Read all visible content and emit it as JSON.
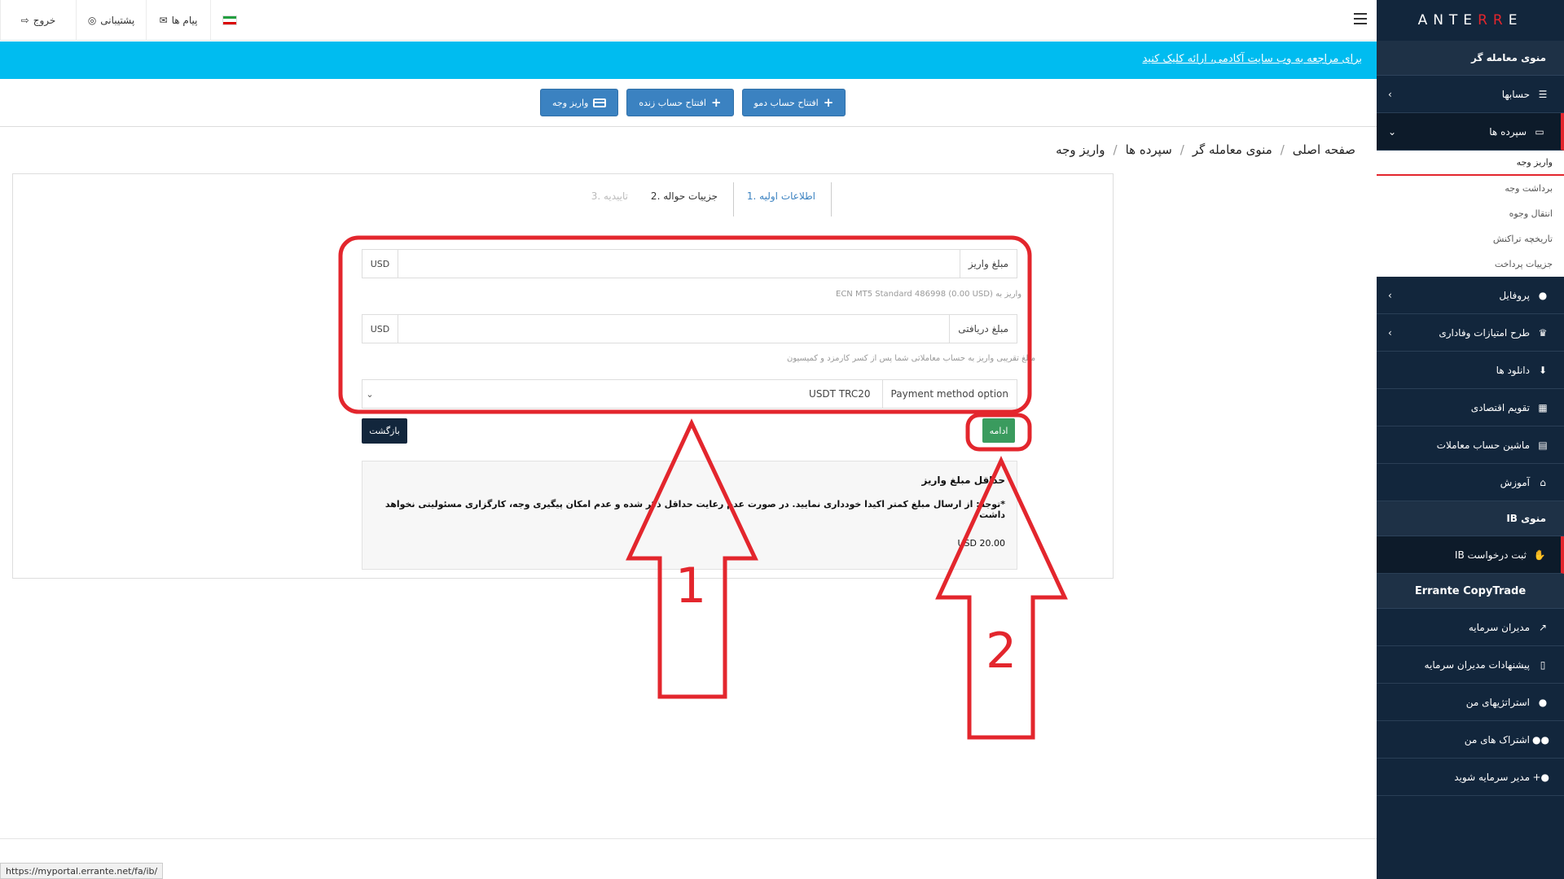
{
  "logo": {
    "text_left": "E",
    "text_rr": "RR",
    "text_right": "ANTE"
  },
  "sidebar": {
    "section_trader": "منوی معامله گر",
    "items_trader": [
      {
        "label": "حسابها",
        "icon": "list-icon",
        "chevron": "›"
      },
      {
        "label": "سپرده ها",
        "icon": "wallet-icon",
        "chevron": "⌄"
      }
    ],
    "sub_items": [
      "واریز وجه",
      "برداشت وجه",
      "انتقال وجوه",
      "تاریخچه تراکنش",
      "جزییات پرداخت"
    ],
    "items_trader2": [
      {
        "label": "پروفایل",
        "icon": "user-icon",
        "chevron": "›"
      },
      {
        "label": "طرح امتیازات وفاداری",
        "icon": "trophy-icon",
        "chevron": "›"
      },
      {
        "label": "دانلود ها",
        "icon": "download-icon"
      },
      {
        "label": "تقویم اقتصادی",
        "icon": "calendar-icon"
      },
      {
        "label": "ماشین حساب معاملات",
        "icon": "calculator-icon"
      },
      {
        "label": "آموزش",
        "icon": "bank-icon"
      }
    ],
    "section_ib": "منوی IB",
    "item_ib": {
      "label": "ثبت درخواست IB",
      "icon": "handshake-icon"
    },
    "section_copy": "Errante CopyTrade",
    "items_copy": [
      {
        "label": "مدیران سرمایه",
        "icon": "chart-icon"
      },
      {
        "label": "پیشنهادات مدیران سرمایه",
        "icon": "tablet-icon"
      },
      {
        "label": "استراتژیهای من",
        "icon": "user-tie-icon"
      },
      {
        "label": "اشتراک های من",
        "icon": "users-icon"
      },
      {
        "label": "مدیر سرمایه شوید",
        "icon": "user-plus-icon"
      }
    ]
  },
  "topbar": {
    "logout": "خروج",
    "support": "پشتیبانی",
    "messages": "پیام ها"
  },
  "banner": {
    "link": "برای مراجعه به وب سایت آکادمی، ارائه کلیک کنید"
  },
  "actions": {
    "demo": "افتتاح حساب دمو",
    "live": "افتتاح حساب زنده",
    "deposit": "واریز وجه"
  },
  "breadcrumb": [
    "صفحه اصلی",
    "منوی معامله گر",
    "سپرده ها",
    "واریز وجه"
  ],
  "steps": [
    "اطلاعات اولیه .1",
    "جزییات حواله .2",
    "تاییدیه .3"
  ],
  "form": {
    "deposit_label": "مبلغ واریز",
    "deposit_unit": "USD",
    "deposit_hint": "واریز به ECN MT5 Standard 486998 (0.00 USD)",
    "receive_label": "مبلغ دریافتی",
    "receive_unit": "USD",
    "receive_hint": "مبلغ تقریبی واریز به حساب معاملاتی شما پس از کسر کارمزد و کمیسیون",
    "method_label": "Payment method option",
    "method_value": "USDT TRC20",
    "back": "بازگشت",
    "continue": "ادامه"
  },
  "info": {
    "title": "حداقل مبلغ واریز",
    "warning": "*توجه: از ارسال مبلغ کمتر اکیدا خودداری نمایید. در صورت عدم رعایت حداقل ذکر شده و عدم امکان پیگیری وجه، کارگزاری مسئولیتی نخواهد داشت",
    "amount": "USD 20.00"
  },
  "annotations": {
    "one": "1",
    "two": "2"
  },
  "statusbar": "https://myportal.errante.net/fa/ib/",
  "colors": {
    "sidebar": "#12263c",
    "banner": "#00bcf0",
    "button": "#3b82c1",
    "accent": "#e3262d",
    "success": "#3a9b5e"
  }
}
